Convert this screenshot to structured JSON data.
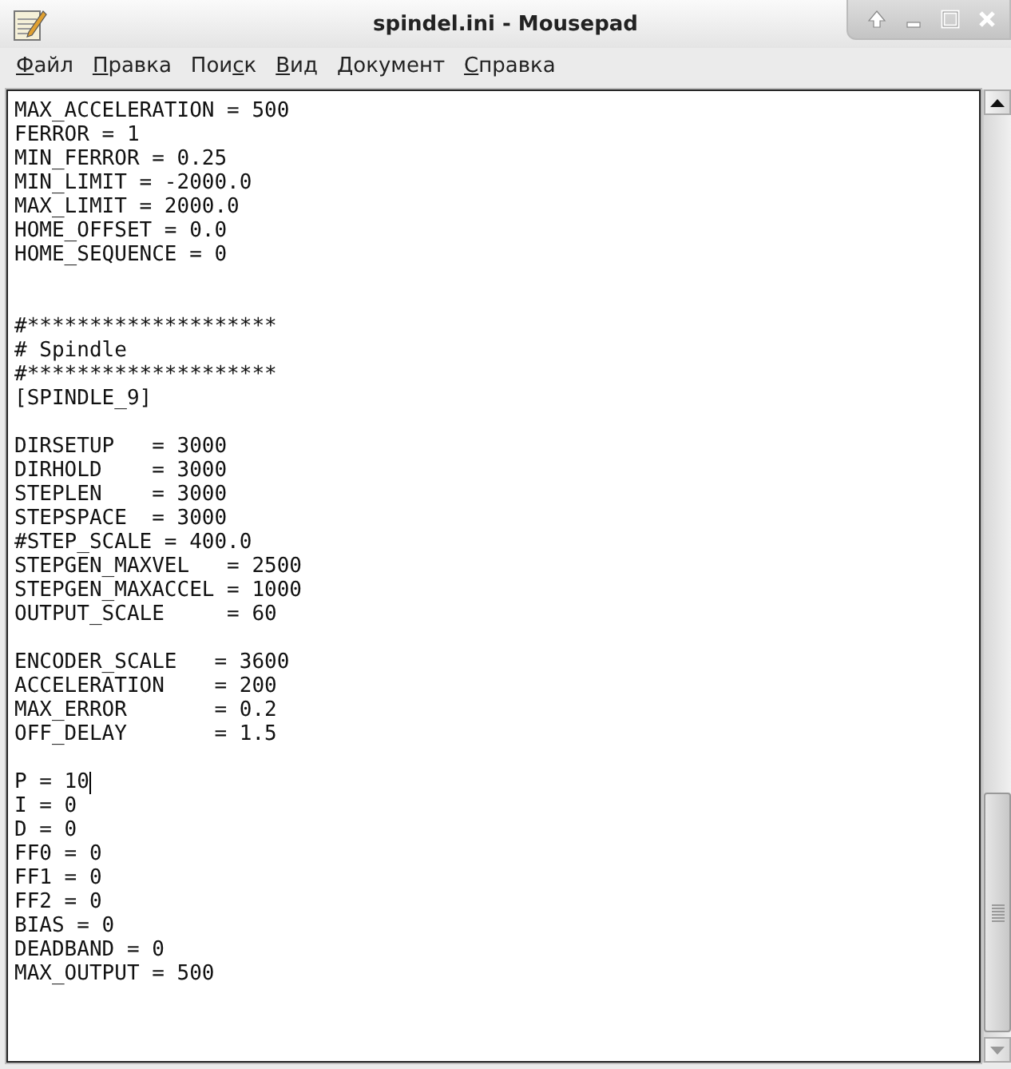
{
  "window": {
    "title": "spindel.ini - Mousepad"
  },
  "menu": [
    {
      "key": "Ф",
      "post": "айл"
    },
    {
      "key": "П",
      "post": "равка"
    },
    {
      "pre": "Пои",
      "key": "с",
      "post": "к"
    },
    {
      "key": "В",
      "post": "ид"
    },
    {
      "pre": "Документ"
    },
    {
      "key": "С",
      "post": "правка"
    }
  ],
  "editor": {
    "lines": [
      {
        "kind": "text",
        "text": "MAX_ACCELERATION = 500"
      },
      {
        "kind": "text",
        "text": "FERROR = 1"
      },
      {
        "kind": "text",
        "text": "MIN_FERROR = 0.25"
      },
      {
        "kind": "text",
        "text": "MIN_LIMIT = -2000.0"
      },
      {
        "kind": "text",
        "text": "MAX_LIMIT = 2000.0"
      },
      {
        "kind": "text",
        "text": "HOME_OFFSET = 0.0"
      },
      {
        "kind": "text",
        "text": "HOME_SEQUENCE = 0"
      },
      {
        "kind": "blank"
      },
      {
        "kind": "blank"
      },
      {
        "kind": "text",
        "text": "#********************"
      },
      {
        "kind": "text",
        "text": "# Spindle"
      },
      {
        "kind": "text",
        "text": "#********************"
      },
      {
        "kind": "text",
        "text": "[SPINDLE_9]"
      },
      {
        "kind": "blank"
      },
      {
        "kind": "text",
        "text": "DIRSETUP   = 3000"
      },
      {
        "kind": "text",
        "text": "DIRHOLD    = 3000"
      },
      {
        "kind": "text",
        "text": "STEPLEN    = 3000"
      },
      {
        "kind": "text",
        "text": "STEPSPACE  = 3000"
      },
      {
        "kind": "text",
        "text": "#STEP_SCALE = 400.0"
      },
      {
        "kind": "text",
        "text": "STEPGEN_MAXVEL   = 2500"
      },
      {
        "kind": "text",
        "text": "STEPGEN_MAXACCEL = 1000"
      },
      {
        "kind": "text",
        "text": "OUTPUT_SCALE     = 60"
      },
      {
        "kind": "blank"
      },
      {
        "kind": "text",
        "text": "ENCODER_SCALE   = 3600"
      },
      {
        "kind": "text",
        "text": "ACCELERATION    = 200"
      },
      {
        "kind": "text",
        "text": "MAX_ERROR       = 0.2"
      },
      {
        "kind": "text",
        "text": "OFF_DELAY       = 1.5"
      },
      {
        "kind": "blank"
      },
      {
        "kind": "text",
        "text": "P = 10",
        "cursor": true
      },
      {
        "kind": "text",
        "text": "I = 0"
      },
      {
        "kind": "text",
        "text": "D = 0"
      },
      {
        "kind": "text",
        "text": "FF0 = 0"
      },
      {
        "kind": "text",
        "text": "FF1 = 0"
      },
      {
        "kind": "text",
        "text": "FF2 = 0"
      },
      {
        "kind": "text",
        "text": "BIAS = 0"
      },
      {
        "kind": "text",
        "text": "DEADBAND = 0"
      },
      {
        "kind": "text",
        "text": "MAX_OUTPUT = 500"
      }
    ]
  }
}
